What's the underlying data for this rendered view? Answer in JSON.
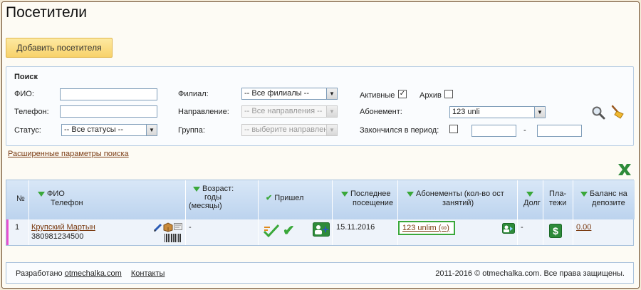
{
  "page": {
    "title": "Посетители"
  },
  "toolbar": {
    "add_label": "Добавить посетителя"
  },
  "search": {
    "title": "Поиск",
    "fio_label": "ФИО:",
    "phone_label": "Телефон:",
    "status_label": "Статус:",
    "status_value": "-- Все статусы --",
    "branch_label": "Филиал:",
    "branch_value": "-- Все филиалы --",
    "direction_label": "Направление:",
    "direction_value": "-- Все направления --",
    "group_label": "Группа:",
    "group_value": "-- выберите направление --",
    "active_label": "Активные",
    "active_checked": true,
    "archive_label": "Архив",
    "archive_checked": false,
    "subscription_label": "Абонемент:",
    "subscription_value": "123 unli",
    "ended_label": "Закончился в период:",
    "ended_checked": false,
    "date_separator": "-",
    "extended_link": "Расширенные параметры поиска"
  },
  "table": {
    "headers": {
      "num": "№",
      "fio": "ФИО",
      "fio_sub": "Телефон",
      "age": "Возраст:",
      "age_sub1": "годы",
      "age_sub2": "(месяцы)",
      "came": "Пришел",
      "last_visit": "Последнее",
      "last_visit_sub": "посещение",
      "subs": "Абонементы (кол-во ост",
      "subs_sub": "занятий)",
      "debt": "Долг",
      "payments": "Пла-",
      "payments_sub": "тежи",
      "balance": "Баланс на",
      "balance_sub": "депозите"
    },
    "rows": [
      {
        "num": "1",
        "name": "Крупский Мартын",
        "phone": "380981234500",
        "age": "-",
        "last_visit": "15.11.2016",
        "subscription": "123 unlim (∞)",
        "debt": "-",
        "balance": "0.00"
      }
    ]
  },
  "footer": {
    "dev_prefix": "Разработано",
    "dev_link": "otmechalka.com",
    "contacts": "Контакты",
    "copyright": "2011-2016 © otmechalka.com. Все права защищены."
  },
  "colors": {
    "accent_green": "#3aa83a",
    "link": "#7a3b12",
    "row_marker": "#e64fd0"
  }
}
